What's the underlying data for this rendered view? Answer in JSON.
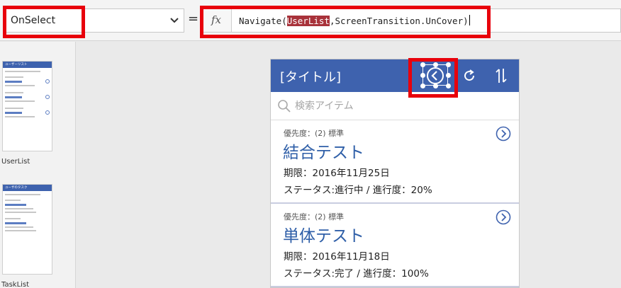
{
  "formula_bar": {
    "property": "OnSelect",
    "equals": "=",
    "fx_label": "fx",
    "formula_prefix": "Navigate(",
    "formula_highlight": "UserList",
    "formula_suffix": ",ScreenTransition.UnCover)"
  },
  "screens": [
    {
      "name": "UserList",
      "header": "ユーザーリスト",
      "entries": [
        "ユーザ１",
        "ユーザ２",
        "ユーザ３"
      ]
    },
    {
      "name": "TaskList",
      "header": "ユーザのタスク",
      "entries": [
        "結合テスト",
        "単体テスト"
      ]
    }
  ],
  "app": {
    "title": "[タイトル]",
    "search_placeholder": "検索アイテム",
    "header_color": "#3e62ae",
    "items": [
      {
        "priority": "優先度：(2) 標準",
        "name": "結合テスト",
        "due": "期限：2016年11月25日",
        "status": "ステータス:進行中 / 進行度：20%"
      },
      {
        "priority": "優先度：(2) 標準",
        "name": "単体テスト",
        "due": "期限：2016年11月18日",
        "status": "ステータス:完了 / 進行度：100%"
      }
    ]
  },
  "highlight_color": "#e8000b",
  "icons": [
    "chevron-down-icon",
    "fx-icon",
    "back-icon",
    "refresh-icon",
    "sort-icon",
    "search-icon",
    "chevron-right-circle-icon"
  ]
}
